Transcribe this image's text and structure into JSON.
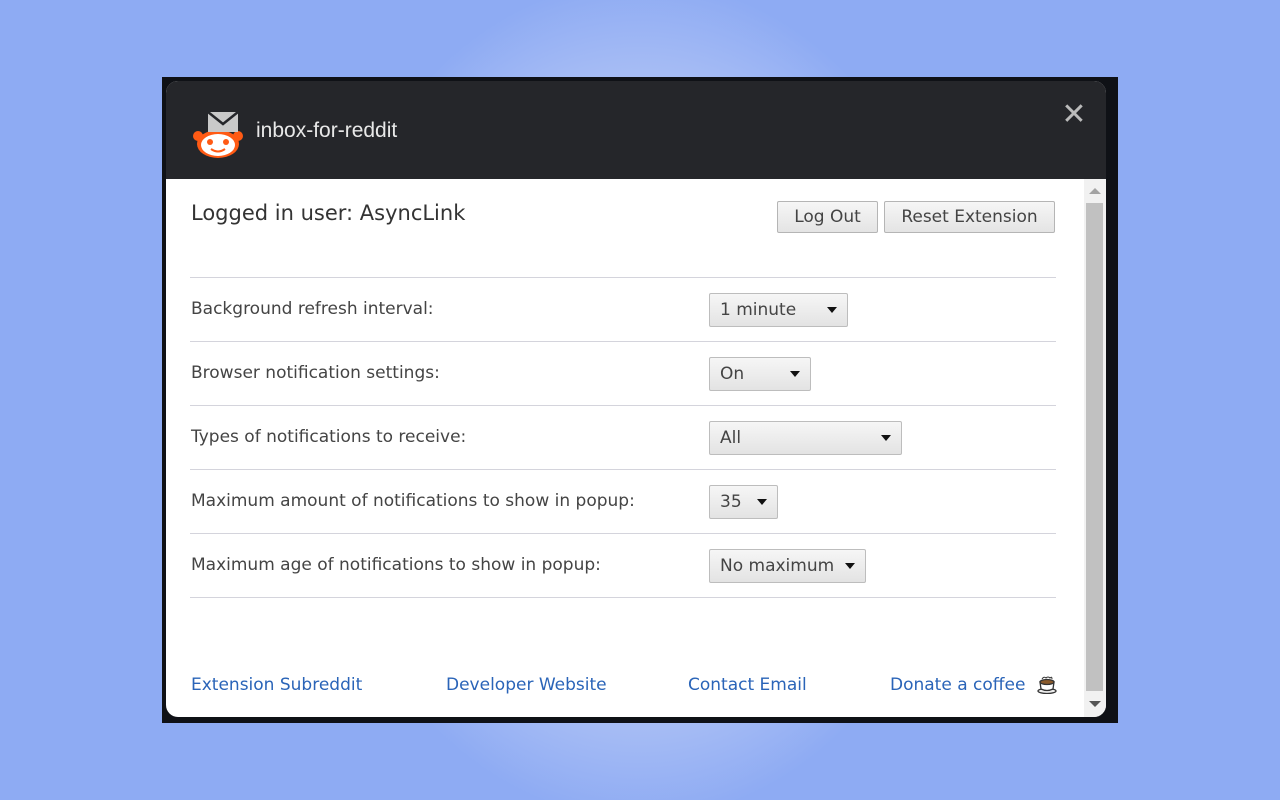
{
  "app": {
    "title": "inbox-for-reddit",
    "logo_icon": "reddit-mail-icon",
    "close_icon": "close-icon"
  },
  "account": {
    "logged_in_label": "Logged in user: AsyncLink",
    "logout_label": "Log Out",
    "reset_label": "Reset Extension"
  },
  "settings": [
    {
      "label": "Background refresh interval:",
      "value": "1 minute"
    },
    {
      "label": "Browser notification settings:",
      "value": "On"
    },
    {
      "label": "Types of notifications to receive:",
      "value": "All"
    },
    {
      "label": "Maximum amount of notifications to show in popup:",
      "value": "35"
    },
    {
      "label": "Maximum age of notifications to show in popup:",
      "value": "No maximum"
    }
  ],
  "footer": {
    "links": [
      {
        "label": "Extension Subreddit"
      },
      {
        "label": "Developer Website"
      },
      {
        "label": "Contact Email"
      },
      {
        "label": "Donate a coffee",
        "icon": "coffee-cup-icon"
      }
    ]
  },
  "colors": {
    "header_bg": "#25262a",
    "link": "#2a64b8",
    "logo_orange": "#ff4500",
    "page_bg": "#8eabf3"
  }
}
